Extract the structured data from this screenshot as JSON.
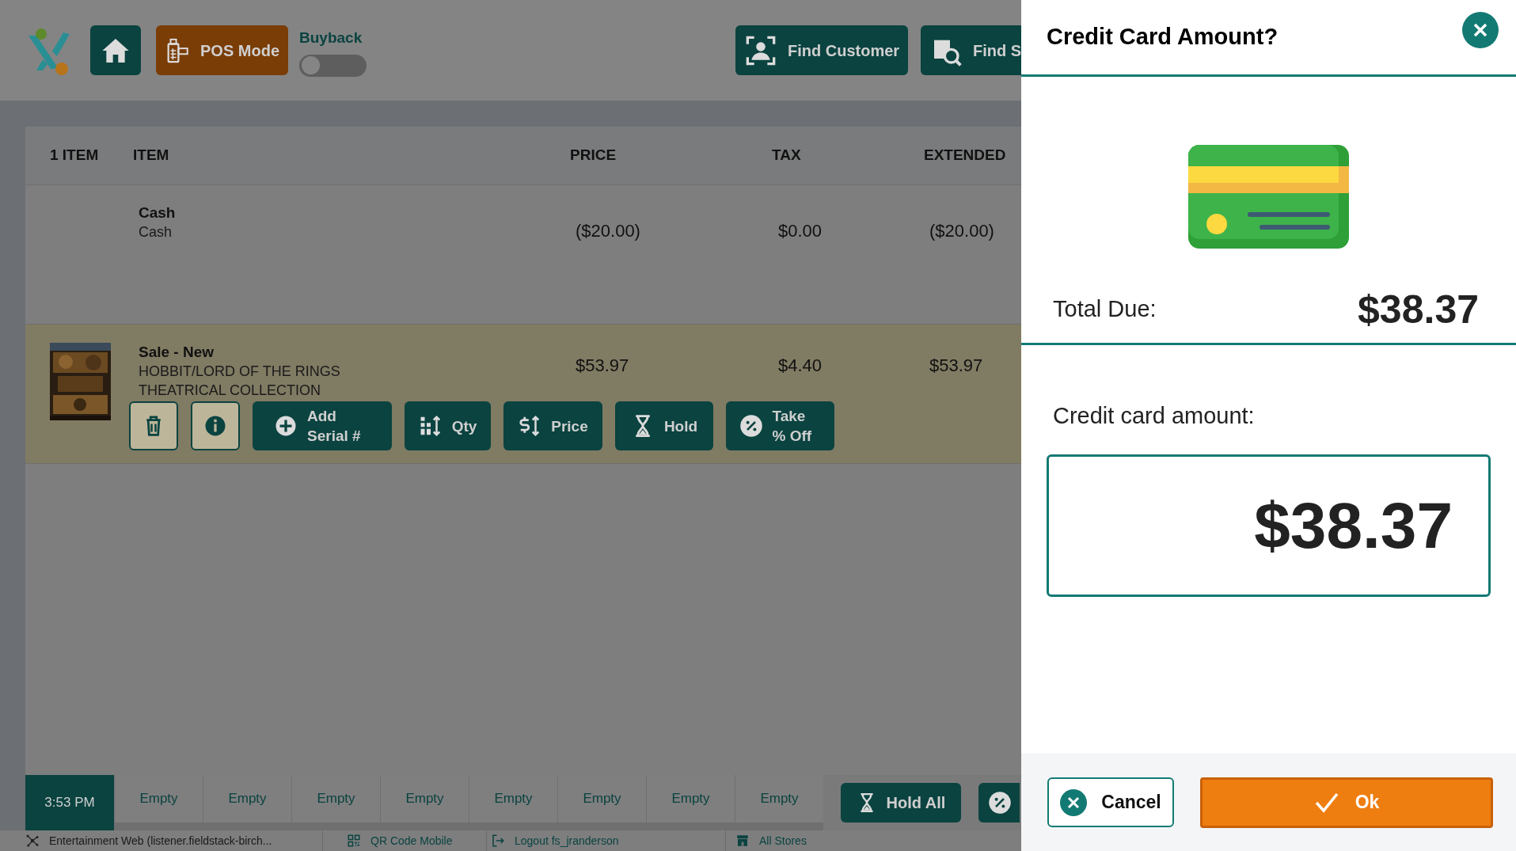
{
  "header": {
    "pos_mode": {
      "label": "POS Mode",
      "selected": true
    },
    "buyback": {
      "label": "Buyback",
      "on": false
    },
    "actions": [
      "Find Customer",
      "Find S"
    ]
  },
  "table": {
    "columns": [
      "1 ITEM",
      "ITEM",
      "PRICE",
      "TAX",
      "EXTENDED"
    ],
    "rows": [
      {
        "kind": "tender",
        "title": "Cash",
        "subtitle": "Cash",
        "price": "($20.00)",
        "tax": "$0.00",
        "extended": "($20.00)",
        "selected": false
      },
      {
        "kind": "sale",
        "title": "Sale - New",
        "subtitle": "HOBBIT/LORD OF THE RINGS THEATRICAL COLLECTION",
        "price": "$53.97",
        "tax": "$4.40",
        "extended": "$53.97",
        "selected": true,
        "actions": [
          {
            "kind": "outline"
          },
          {
            "kind": "outline"
          },
          {
            "kind": "solid",
            "label": "Add Serial #"
          },
          {
            "kind": "solid",
            "label": "Qty"
          },
          {
            "kind": "solid",
            "label": "Price"
          },
          {
            "kind": "solid",
            "label": "Hold"
          },
          {
            "kind": "solid",
            "label": "Take % Off"
          }
        ]
      }
    ]
  },
  "hold_bar": {
    "time": "3:53 PM",
    "slots": [
      "Empty",
      "Empty",
      "Empty",
      "Empty",
      "Empty",
      "Empty",
      "Empty",
      "Empty"
    ],
    "hold_all": "Hold All"
  },
  "status_bar": [
    "Entertainment Web (listener.fieldstack-birch...",
    "QR Code Mobile",
    "Logout fs_jranderson",
    "All Stores"
  ],
  "dialog": {
    "title": "Credit Card Amount?",
    "total_label": "Total Due:",
    "total_value": "$38.37",
    "amount_label": "Credit card amount:",
    "amount_value": "$38.37",
    "cancel": "Cancel",
    "ok": "Ok"
  }
}
